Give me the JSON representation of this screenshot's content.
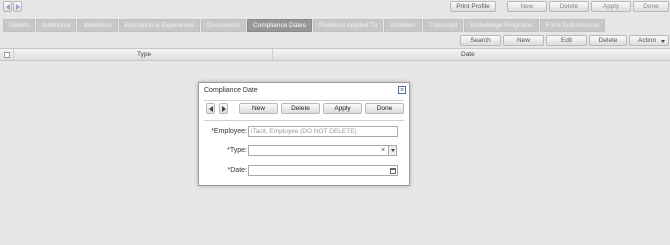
{
  "toolbar": {
    "print_profile": "Print Profile",
    "new": "New",
    "delete": "Delete",
    "apply": "Apply",
    "done": "Done"
  },
  "tabs": [
    {
      "label": "Details"
    },
    {
      "label": "Additional"
    },
    {
      "label": "Identifiers"
    },
    {
      "label": "Education & Experience"
    },
    {
      "label": "Documents"
    },
    {
      "label": "Compliance Dates"
    },
    {
      "label": "Positions Applied To"
    },
    {
      "label": "Activities"
    },
    {
      "label": "Transcript"
    },
    {
      "label": "Knowledge Programs"
    },
    {
      "label": "Form Submissions"
    }
  ],
  "active_tab": "Compliance Dates",
  "grid_toolbar": {
    "search": "Search",
    "new": "New",
    "edit": "Edit",
    "delete": "Delete",
    "action": "Action"
  },
  "grid": {
    "columns": [
      "Type",
      "Date"
    ]
  },
  "dialog": {
    "title": "Compliance Date",
    "buttons": {
      "new": "New",
      "delete": "Delete",
      "apply": "Apply",
      "done": "Done"
    },
    "fields": {
      "employee_label": "*Employee:",
      "employee_value": "iTacit, Employee (DO NOT DELETE)",
      "type_label": "*Type:",
      "type_value": "",
      "date_label": "*Date:",
      "date_value": ""
    }
  }
}
